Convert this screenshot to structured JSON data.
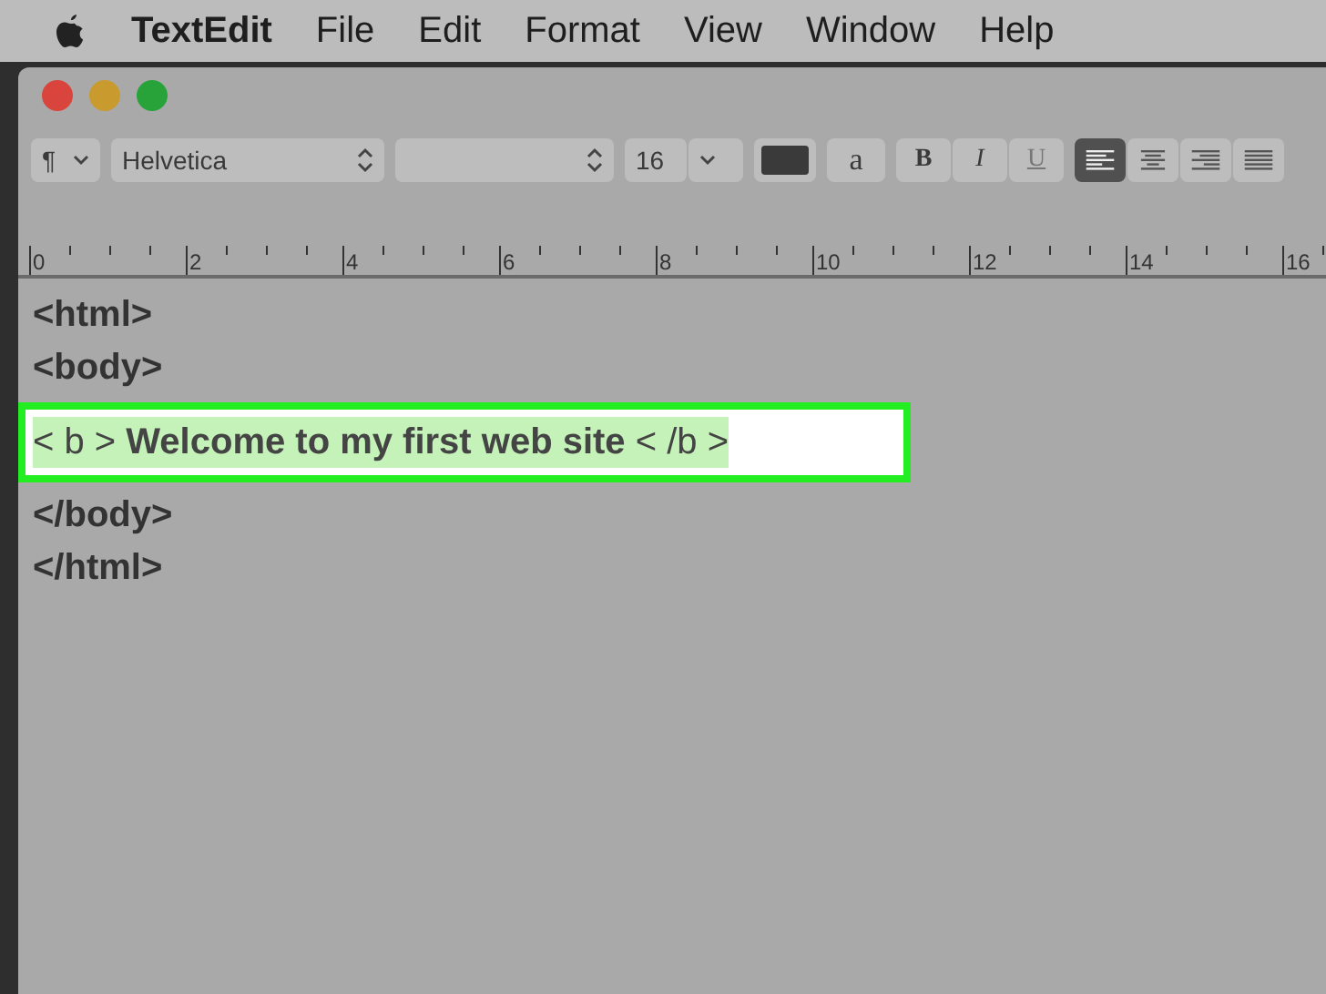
{
  "menu_bar": {
    "app": "TextEdit",
    "items": [
      "File",
      "Edit",
      "Format",
      "View",
      "Window",
      "Help"
    ]
  },
  "toolbar": {
    "paragraph": "¶",
    "font_family": "Helvetica",
    "font_size": "16",
    "text_style": "a",
    "bold": "B",
    "italic": "I",
    "underline": "U",
    "alignment": [
      {
        "kind": "left",
        "selected": true
      },
      {
        "kind": "center",
        "selected": false
      },
      {
        "kind": "right",
        "selected": false
      },
      {
        "kind": "justify",
        "selected": false
      }
    ]
  },
  "ruler": [
    "0",
    "2",
    "4",
    "6",
    "8",
    "10",
    "12",
    "14",
    "16"
  ],
  "document": [
    {
      "kind": "plain",
      "text": "<html>"
    },
    {
      "kind": "plain",
      "text": "<body>"
    },
    {
      "kind": "highlighted",
      "text": "< b > **Welcome to my first web site** < /b >"
    },
    {
      "kind": "plain",
      "text": "</body>"
    },
    {
      "kind": "plain",
      "text": "</html>"
    }
  ]
}
